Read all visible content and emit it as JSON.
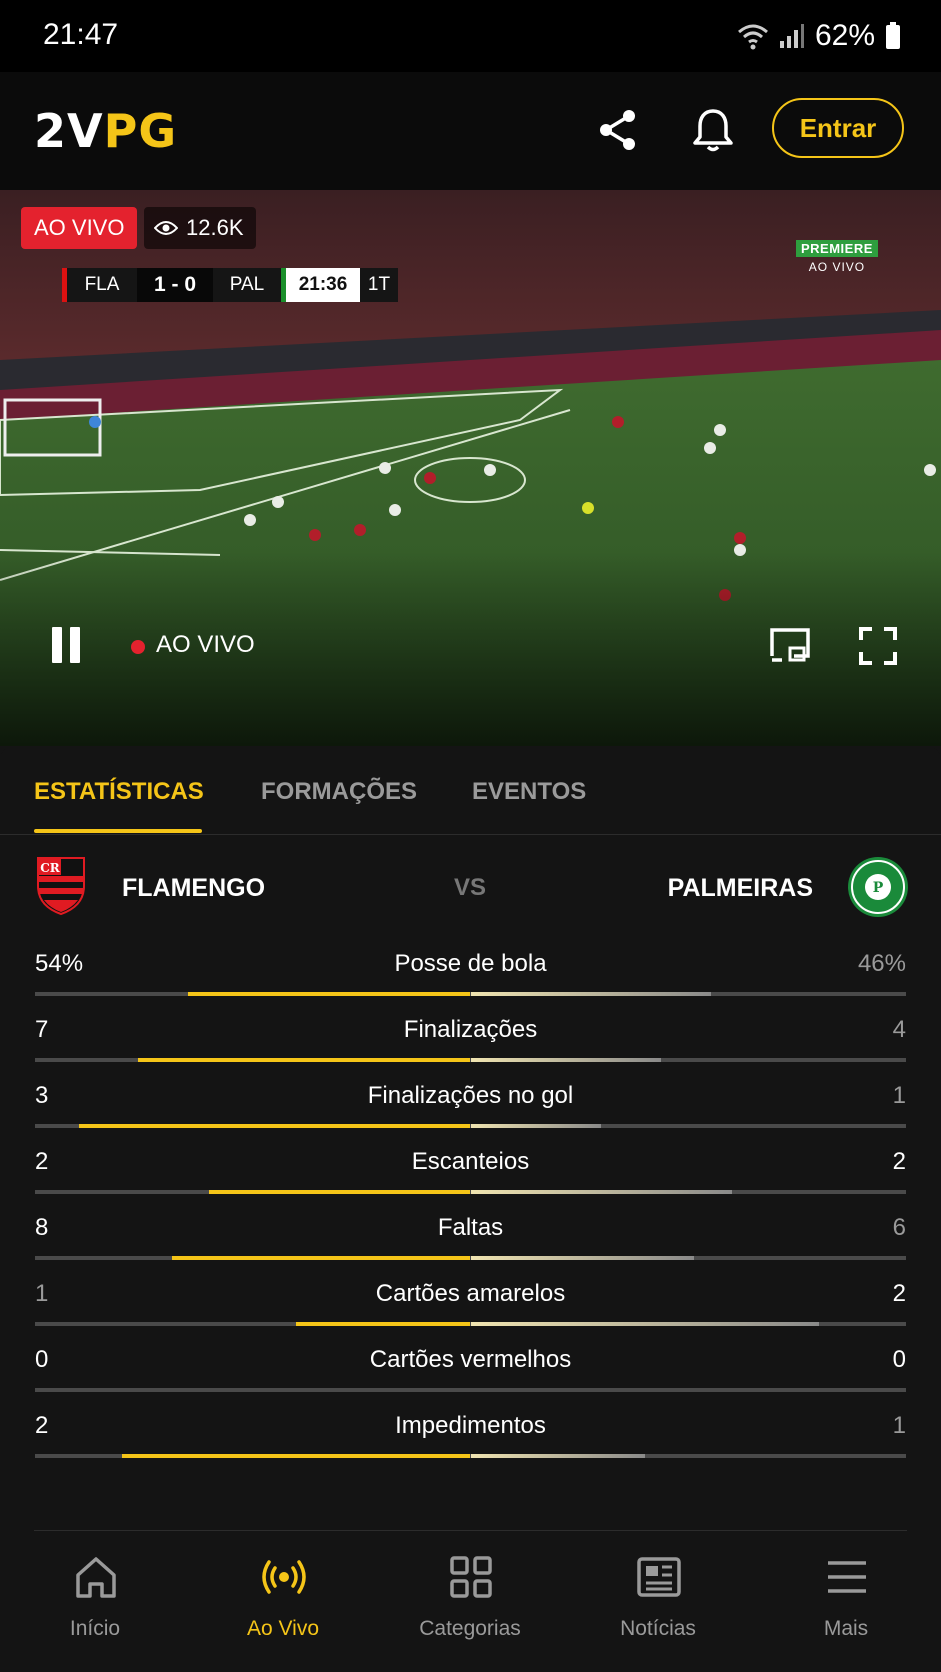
{
  "status_bar": {
    "time": "21:47",
    "battery": "62%"
  },
  "header": {
    "logo_part1": "2V",
    "logo_part2": "PG",
    "login_label": "Entrar",
    "icons": [
      "share-icon",
      "bell-icon"
    ]
  },
  "video": {
    "live_badge": "AO VIVO",
    "viewers": "12.6K",
    "scoreboard": {
      "home": "FLA",
      "score": "1 - 0",
      "away": "PAL",
      "clock": "21:36",
      "period": "1T"
    },
    "channel_name": "PREMIERE",
    "channel_sub": "AO VIVO",
    "control_live_label": "AO VIVO",
    "colors": {
      "live": "#e4222e"
    }
  },
  "tabs": [
    {
      "label": "ESTATÍSTICAS",
      "active": true
    },
    {
      "label": "FORMAÇÕES",
      "active": false
    },
    {
      "label": "EVENTOS",
      "active": false
    }
  ],
  "match": {
    "home_team": "FLAMENGO",
    "vs": "VS",
    "away_team": "PALMEIRAS"
  },
  "stats": [
    {
      "label": "Posse de bola",
      "home": "54%",
      "away": "46%"
    },
    {
      "label": "Finalizações",
      "home": "7",
      "away": "4"
    },
    {
      "label": "Finalizações no gol",
      "home": "3",
      "away": "1"
    },
    {
      "label": "Escanteios",
      "home": "2",
      "away": "2"
    },
    {
      "label": "Faltas",
      "home": "8",
      "away": "6"
    },
    {
      "label": "Cartões amarelos",
      "home": "1",
      "away": "2"
    },
    {
      "label": "Cartões vermelhos",
      "home": "0",
      "away": "0"
    },
    {
      "label": "Impedimentos",
      "home": "2",
      "away": "1"
    }
  ],
  "nav": [
    {
      "label": "Início",
      "icon": "home-icon",
      "active": false
    },
    {
      "label": "Ao Vivo",
      "icon": "live-broadcast-icon",
      "active": true
    },
    {
      "label": "Categorias",
      "icon": "grid-icon",
      "active": false
    },
    {
      "label": "Notícias",
      "icon": "newspaper-icon",
      "active": false
    },
    {
      "label": "Mais",
      "icon": "menu-icon",
      "active": false
    }
  ],
  "accent_color": "#f5c518"
}
